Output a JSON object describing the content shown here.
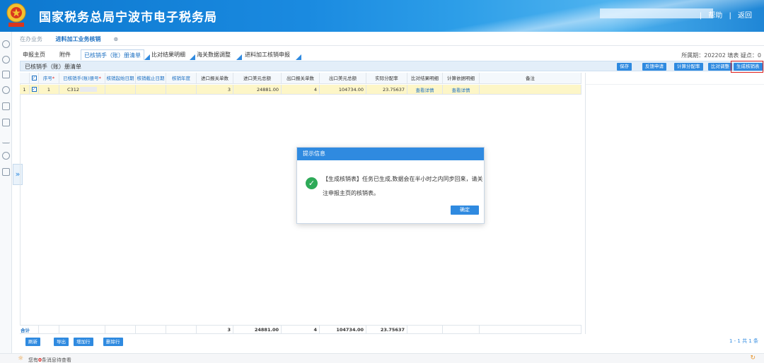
{
  "header": {
    "title": "国家税务总局宁波市电子税务局",
    "links": [
      "帮助",
      "返回"
    ],
    "separator": "|"
  },
  "page_tabs": {
    "inactive": "在办业务",
    "active": "进料加工业务核销",
    "close_icon": "close-circle-icon"
  },
  "sub_tabs": [
    "申报主页",
    "附件",
    "已核销手（账）册清单",
    "比对结果明细",
    "海关数据调整",
    "进料加工核销申报"
  ],
  "period_info": "所属期：202202  填表  疑点：0",
  "panel": {
    "title": "已核销手（账）册清单",
    "actions": [
      "保存",
      "反馈申请",
      "计算分配率",
      "比对调整",
      "生成核销表"
    ]
  },
  "grid": {
    "headers": [
      "序号",
      "已核销手(账)册号",
      "核销起始日期",
      "核销截止日期",
      "核销年度",
      "进口报关单数",
      "进口美元总额",
      "出口报关单数",
      "出口美元总额",
      "实际分配率",
      "比对结果明细",
      "计算依据明细",
      "备注"
    ],
    "rows": [
      {
        "row_no": "1",
        "seq": "1",
        "book_no": "C312",
        "start": "",
        "end": "",
        "year": "",
        "import_count": "3",
        "import_usd": "24881.00",
        "export_count": "4",
        "export_usd": "104734.00",
        "rate": "23.75637",
        "compare_link": "查看详情",
        "calc_link": "查看详情",
        "note": ""
      }
    ],
    "total": {
      "label": "合计",
      "import_count": "3",
      "import_usd": "24881.00",
      "export_count": "4",
      "export_usd": "104734.00",
      "rate": "23.75637"
    }
  },
  "bottom_buttons": [
    "刷新",
    "导出",
    "增加行",
    "删除行"
  ],
  "pager": "1 - 1  共 1 条",
  "status": {
    "prefix": "您有",
    "count": "0",
    "suffix": "条消息待查看"
  },
  "dialog": {
    "title": "提示信息",
    "message": "【生成核销表】任务已生成,数据会在半小时之内同步回来，请关注申报主页的核销表。",
    "ok_label": "确定"
  },
  "colors": {
    "header_blue": "#0d78cf",
    "accent": "#2f8ae0",
    "highlight_row": "#fdf6c7",
    "success": "#2eaa58",
    "alert_red": "#e0221e"
  }
}
